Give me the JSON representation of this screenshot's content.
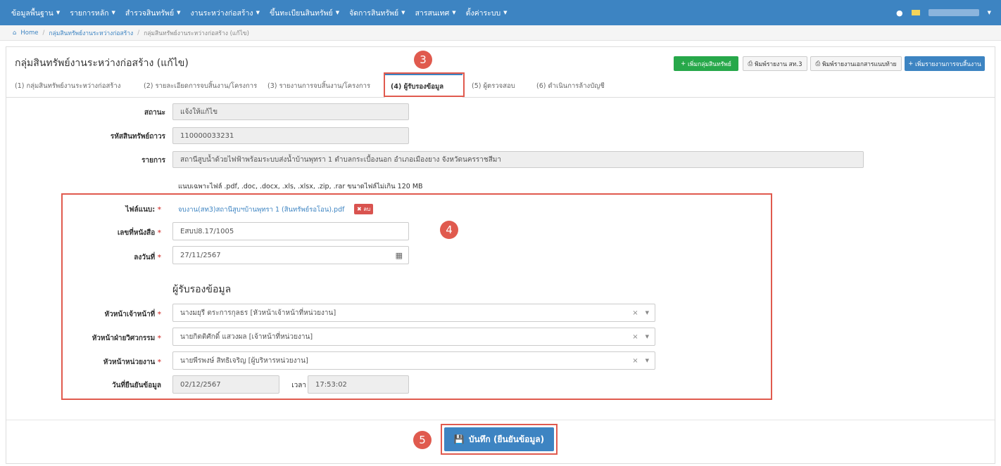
{
  "nav": {
    "items": [
      "ข้อมูลพื้นฐาน",
      "รายการหลัก",
      "สำรวจสินทรัพย์",
      "งานระหว่างก่อสร้าง",
      "ขึ้นทะเบียนสินทรัพย์",
      "จัดการสินทรัพย์",
      "สารสนเทศ",
      "ตั้งค่าระบบ"
    ]
  },
  "breadcrumb": {
    "home": "Home",
    "level1": "กลุ่มสินทรัพย์งานระหว่างก่อสร้าง",
    "current": "กลุ่มสินทรัพย์งานระหว่างก่อสร้าง (แก้ไข)"
  },
  "page": {
    "title": "กลุ่มสินทรัพย์งานระหว่างก่อสร้าง (แก้ไข)"
  },
  "toolbar": {
    "add_group": "เพิ่มกลุ่มสินทรัพย์",
    "print_report": "พิมพ์รายงาน สท.3",
    "print_attachment": "พิมพ์รายงานเอกสารแนบท้าย",
    "add_completion": "เพิ่มรายงานการจบสิ้นงาน"
  },
  "tabs": [
    "(1) กลุ่มสินทรัพย์งานระหว่างก่อสร้าง",
    "(2) รายละเอียดการจบสิ้นงาน/โครงการ",
    "(3) รายงานการจบสิ้นงาน/โครงการ",
    "(4) ผู้รับรองข้อมูล",
    "(5) ผู้ตรวจสอบ",
    "(6) ดำเนินการล้างบัญชี"
  ],
  "annotations": {
    "n3": "3",
    "n4": "4",
    "n5": "5"
  },
  "form": {
    "status_label": "สถานะ",
    "status_value": "แจ้งให้แก้ไข",
    "asset_code_label": "รหัสสินทรัพย์ถาวร",
    "asset_code_value": "110000033231",
    "item_label": "รายการ",
    "item_value": "สถานีสูบน้ำด้วยไฟฟ้าพร้อมระบบส่งน้ำบ้านพุทรา 1 ตำบลกระเบื้องนอก อำเภอเมืองยาง จังหวัดนครราชสีมา",
    "file_hint": "แนบเฉพาะไฟล์ .pdf, .doc, .docx, .xls, .xlsx, .zip, .rar ขนาดไฟล์ไม่เกิน 120 MB",
    "attachment_label": "ไฟล์แนบ:",
    "attachment_file": "จบงาน(สท3)สถานีสูบฯบ้านพุทรา 1 (สินทรัพย์รอโอน).pdf",
    "delete_label": "ลบ",
    "doc_no_label": "เลขที่หนังสือ",
    "doc_no_value": "Eสบป8.17/1005",
    "doc_date_label": "ลงวันที่",
    "doc_date_value": "27/11/2567",
    "section_certifier": "ผู้รับรองข้อมูล",
    "head_officer_label": "หัวหน้าเจ้าหน้าที่",
    "head_officer_value": "นางมยุรี ตระการกุลธร [หัวหน้าเจ้าหน้าที่หน่วยงาน]",
    "head_engineer_label": "หัวหน้าฝ่ายวิศวกรรม",
    "head_engineer_value": "นายกิตติศักดิ์ แสวงผล [เจ้าหน้าที่หน่วยงาน]",
    "head_unit_label": "หัวหน้าหน่วยงาน",
    "head_unit_value": "นายพีรพงษ์ สิทธิเจริญ [ผู้บริหารหน่วยงาน]",
    "confirm_date_label": "วันที่ยืนยันข้อมูล",
    "confirm_date_value": "02/12/2567",
    "time_label": "เวลา",
    "time_value": "17:53:02"
  },
  "save": {
    "label": "บันทึก (ยืนยันข้อมูล)"
  }
}
